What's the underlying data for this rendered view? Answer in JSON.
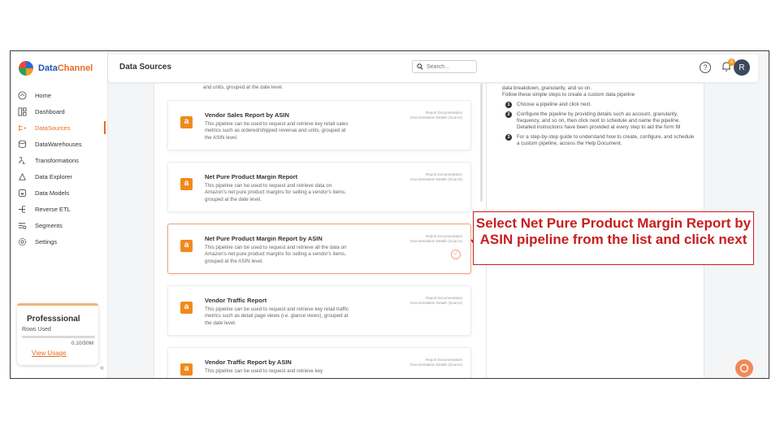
{
  "brand": {
    "name_a": "Data",
    "name_b": "Channel"
  },
  "sidebar": {
    "items": [
      {
        "label": "Home",
        "icon": "home-icon"
      },
      {
        "label": "Dashboard",
        "icon": "dashboard-icon"
      },
      {
        "label": "DataSources",
        "icon": "datasources-icon",
        "active": true
      },
      {
        "label": "DataWarehouses",
        "icon": "database-icon"
      },
      {
        "label": "Transformations",
        "icon": "transform-icon"
      },
      {
        "label": "Data Explorer",
        "icon": "explorer-icon"
      },
      {
        "label": "Data Models",
        "icon": "models-icon"
      },
      {
        "label": "Reverse ETL",
        "icon": "reverse-etl-icon"
      },
      {
        "label": "Segments",
        "icon": "segments-icon"
      },
      {
        "label": "Settings",
        "icon": "settings-icon"
      }
    ],
    "plan": {
      "name": "Professsional",
      "rows_label": "Rows Used",
      "usage": "0.10/50M",
      "progress_fraction": 0.002,
      "view_usage": "View Usage"
    }
  },
  "header": {
    "title": "Data Sources",
    "search_placeholder": "Search...",
    "notification_count": "0",
    "avatar_initial": "R"
  },
  "cards": {
    "partial_top": "and units, grouped at the date level.",
    "links": {
      "doc": "Report Documentation",
      "doc_source": "Documentation Details (Source)"
    },
    "items": [
      {
        "title": "Vendor Sales Report by ASIN",
        "desc": "This pipeline can be used to request and retrieve key retail sales metrics such as ordered/shipped revenue and units, grouped at the ASIN level."
      },
      {
        "title": "Net Pure Product Margin Report",
        "desc": "This pipeline can be used to request and retrieve data on Amazon's net pure product margins for selling a vendor's items, grouped at the date level."
      },
      {
        "title": "Net Pure Product Margin Report by ASIN",
        "desc": "This pipeline can be used to request and retrieve all the data on Amazon's net pure product margins for selling a vendor's items, grouped at the ASIN level.",
        "selected": true
      },
      {
        "title": "Vendor Traffic Report",
        "desc": "This pipeline can be used to request and retrieve key retail traffic metrics such as detail page views (i.e. glance views), grouped at the date level."
      },
      {
        "title": "Vendor Traffic Report by ASIN",
        "desc": "This pipeline can be used to request and retrieve key"
      }
    ]
  },
  "instructions": {
    "intro1": "data breakdown, granularity, and so on.",
    "intro2": "Follow these simple steps to create a custom data pipeline",
    "steps": [
      "Choose a pipeline and click next.",
      "Configure the pipeline by providing details such as account, granularity, frequency, and so on, then click next to schedule and name the pipeline. Detailed instructions have been provided at every step to aid the form fill",
      "For a step-by-step guide to understand how to create, configure, and schedule a custom pipeline, access the Help Document."
    ]
  },
  "callout": {
    "text": "Select Net Pure Product Margin Report by ASIN pipeline from the list and click next"
  },
  "colors": {
    "accent": "#e86b1f",
    "callout": "#c81e1e",
    "amazon": "#f08a1d"
  }
}
